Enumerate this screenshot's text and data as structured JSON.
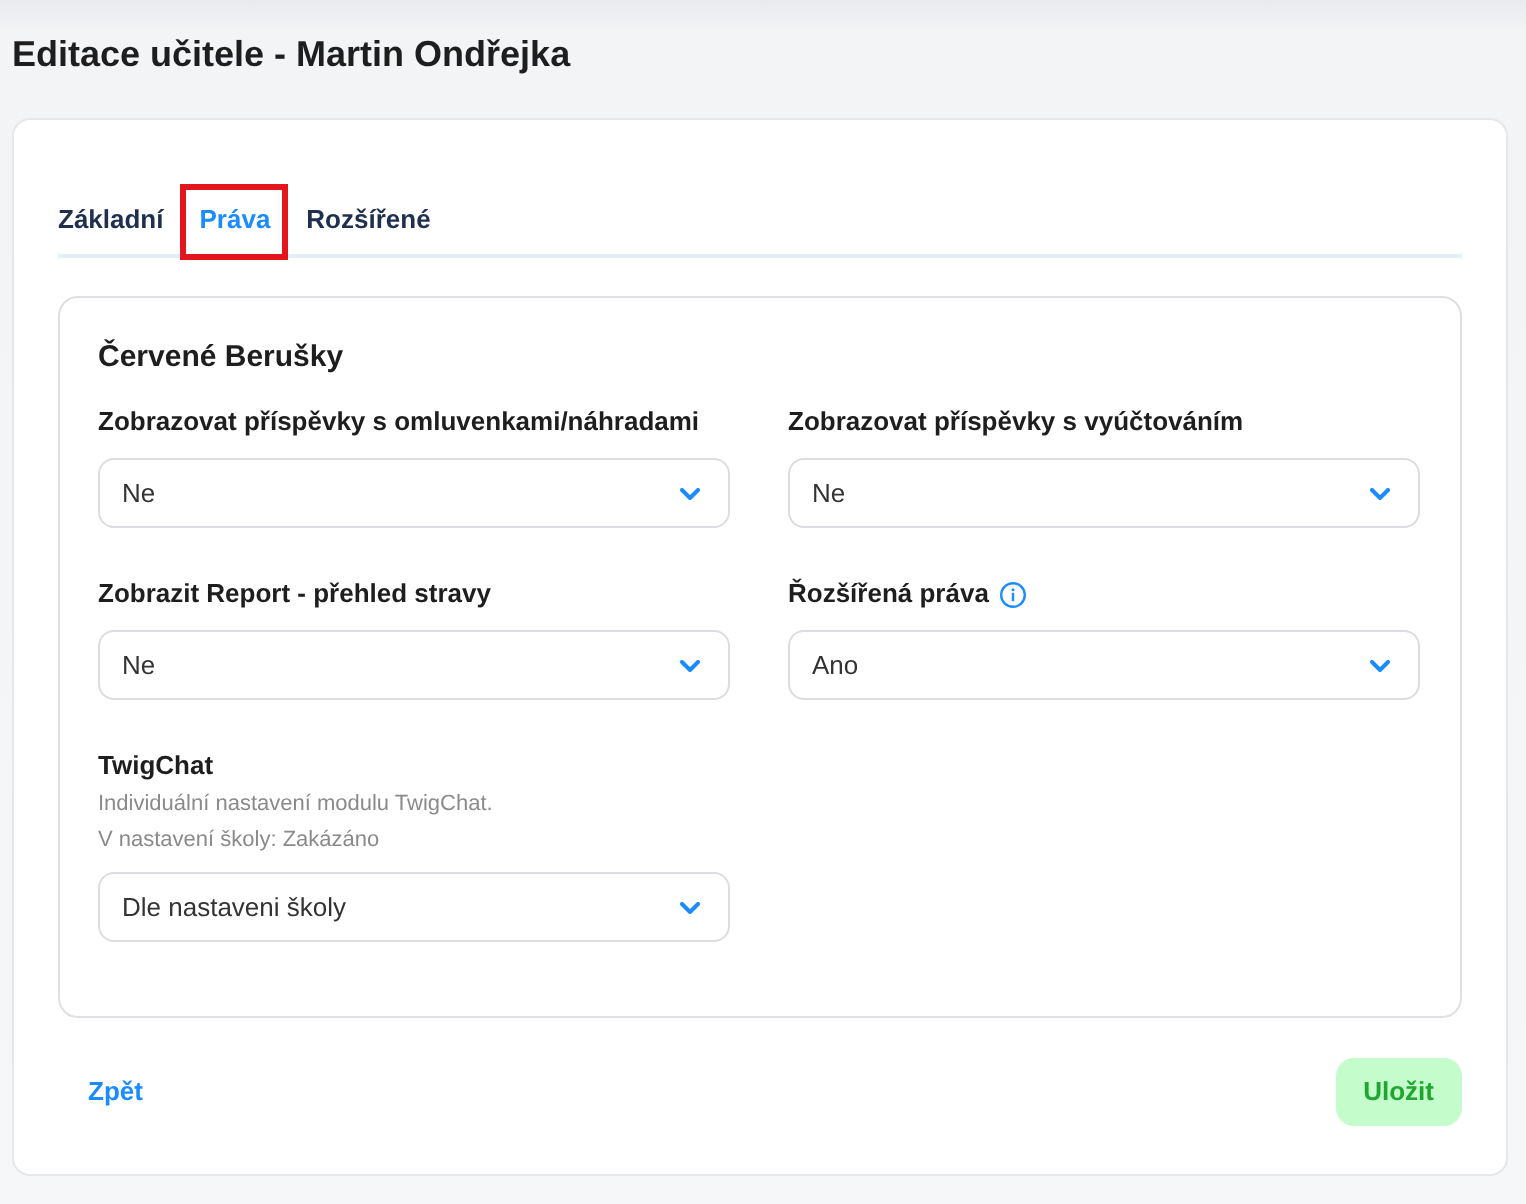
{
  "page": {
    "title": "Editace učitele - Martin Ondřejka"
  },
  "tabs": [
    {
      "label": "Základní",
      "selected": false,
      "highlighted": false
    },
    {
      "label": "Práva",
      "selected": true,
      "highlighted": true
    },
    {
      "label": "Rozšířené",
      "selected": false,
      "highlighted": false
    }
  ],
  "section": {
    "title": "Červené Berušky",
    "fields": [
      {
        "label": "Zobrazovat příspěvky s omluvenkami/náhradami",
        "info": false,
        "value": "Ne"
      },
      {
        "label": "Zobrazovat příspěvky s vyúčtováním",
        "info": false,
        "value": "Ne"
      },
      {
        "label": "Zobrazit Report - přehled stravy",
        "info": false,
        "value": "Ne"
      },
      {
        "label": "Řozšířená práva",
        "info": true,
        "value": "Ano"
      },
      {
        "label": "TwigChat",
        "info": false,
        "description": [
          "Individuální nastavení modulu TwigChat.",
          "V nastavení školy: Zakázáno"
        ],
        "value": "Dle nastaveni školy"
      }
    ]
  },
  "footer": {
    "back_link": "Zpět",
    "save_button": "Uložit"
  }
}
